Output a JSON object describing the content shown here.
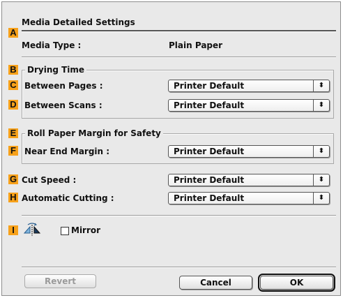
{
  "dialog": {
    "title": "Media Detailed Settings",
    "media_type_label": "Media Type :",
    "media_type_value": "Plain Paper",
    "drying_time": {
      "title": "Drying Time",
      "between_pages_label": "Between Pages :",
      "between_pages_value": "Printer Default",
      "between_scans_label": "Between Scans :",
      "between_scans_value": "Printer Default"
    },
    "roll_margin": {
      "title": "Roll Paper Margin for Safety",
      "near_end_label": "Near End Margin :",
      "near_end_value": "Printer Default"
    },
    "cut_speed_label": "Cut Speed :",
    "cut_speed_value": "Printer Default",
    "auto_cutting_label": "Automatic Cutting :",
    "auto_cutting_value": "Printer Default",
    "mirror_label": "Mirror",
    "mirror_checked": false,
    "revert_label": "Revert",
    "cancel_label": "Cancel",
    "ok_label": "OK"
  },
  "markers": {
    "a": "A",
    "b": "B",
    "c": "C",
    "d": "D",
    "e": "E",
    "f": "F",
    "g": "G",
    "h": "H",
    "i": "I"
  },
  "colors": {
    "marker": "#f7a11a",
    "dialog_bg": "#e9e9e9"
  },
  "icons": {
    "popup_arrow": "up-down-arrows-icon",
    "mirror": "mirror-icon"
  }
}
